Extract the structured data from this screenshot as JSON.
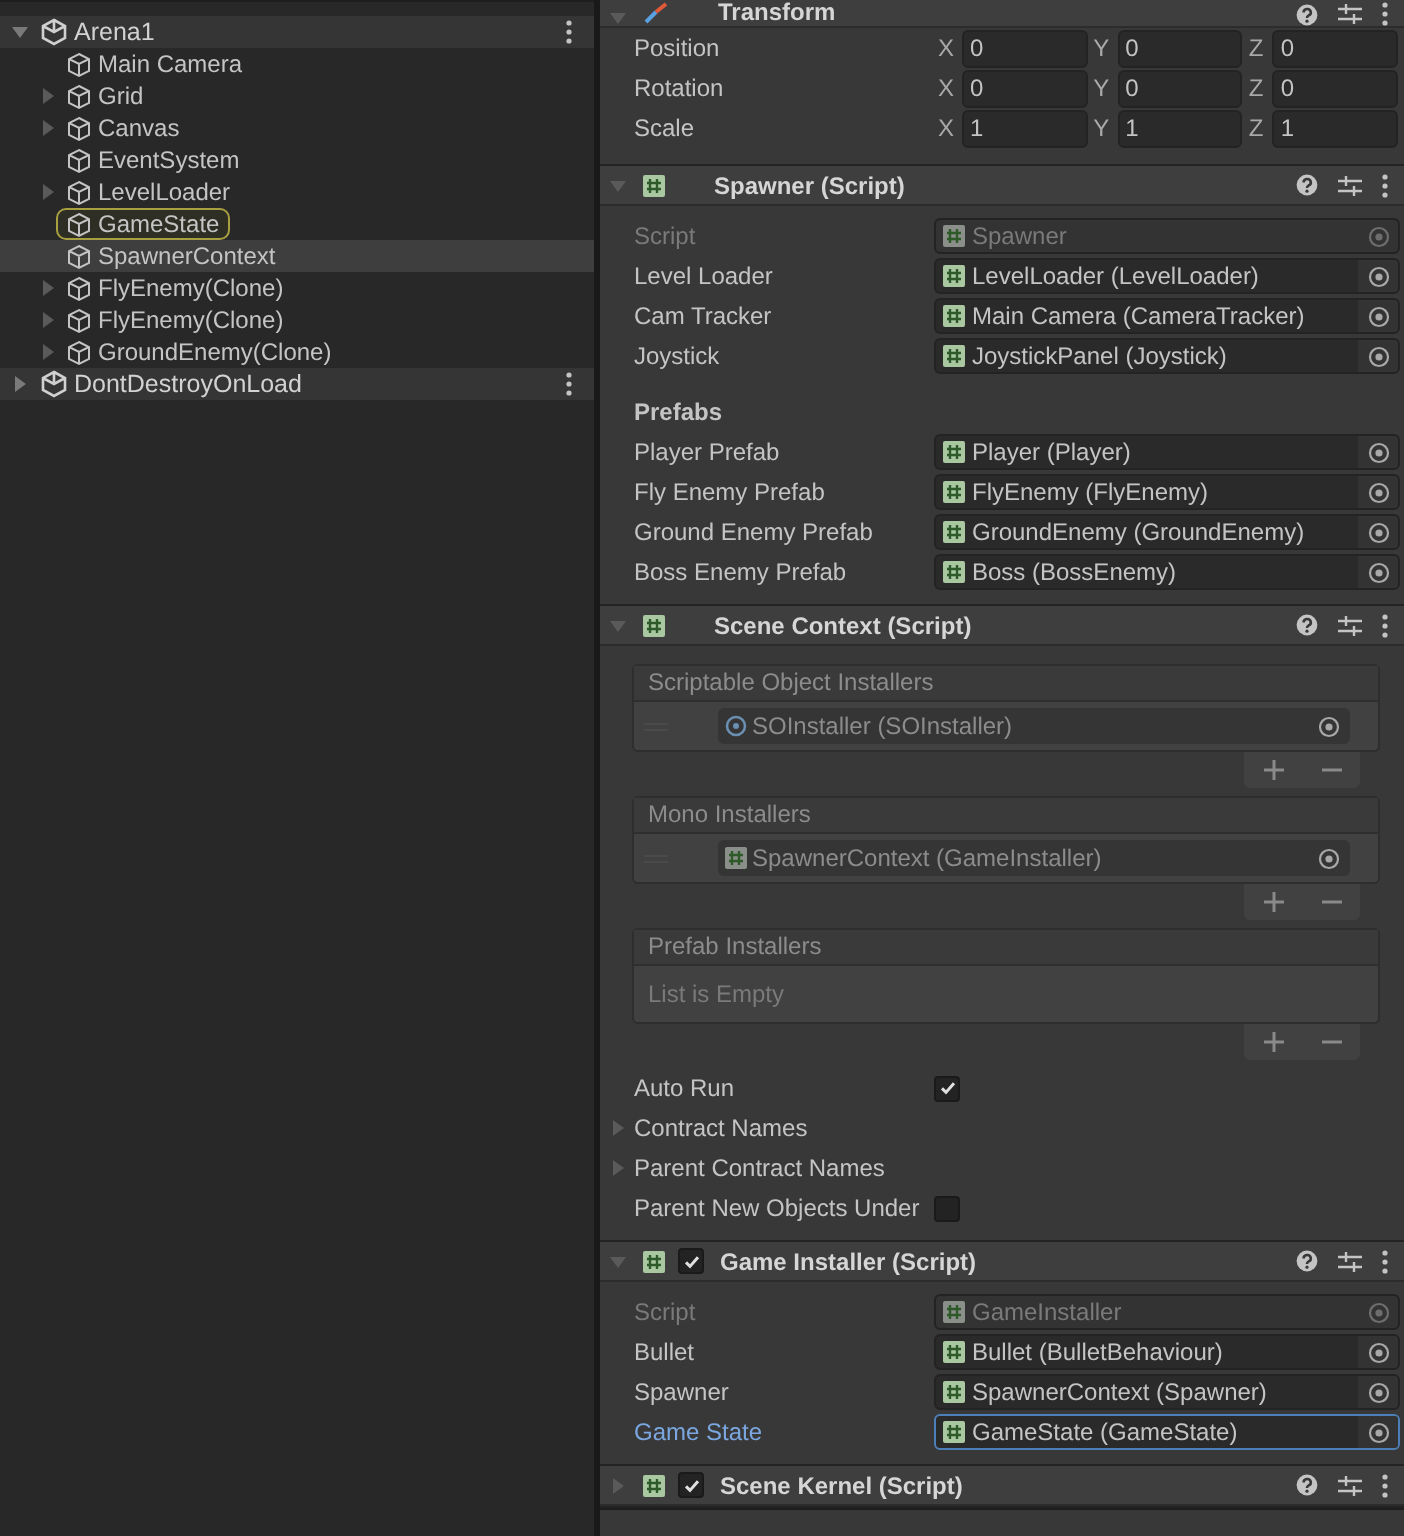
{
  "hierarchy": {
    "scenes": [
      {
        "name": "Arena1",
        "expanded": true,
        "children": [
          {
            "name": "Main Camera",
            "expandable": false,
            "selected": false,
            "pinged": false
          },
          {
            "name": "Grid",
            "expandable": true,
            "selected": false,
            "pinged": false
          },
          {
            "name": "Canvas",
            "expandable": true,
            "selected": false,
            "pinged": false
          },
          {
            "name": "EventSystem",
            "expandable": false,
            "selected": false,
            "pinged": false
          },
          {
            "name": "LevelLoader",
            "expandable": true,
            "selected": false,
            "pinged": false
          },
          {
            "name": "GameState",
            "expandable": false,
            "selected": false,
            "pinged": true
          },
          {
            "name": "SpawnerContext",
            "expandable": false,
            "selected": true,
            "pinged": false
          },
          {
            "name": "FlyEnemy(Clone)",
            "expandable": true,
            "selected": false,
            "pinged": false
          },
          {
            "name": "FlyEnemy(Clone)",
            "expandable": true,
            "selected": false,
            "pinged": false
          },
          {
            "name": "GroundEnemy(Clone)",
            "expandable": true,
            "selected": false,
            "pinged": false
          }
        ]
      },
      {
        "name": "DontDestroyOnLoad",
        "expanded": false
      }
    ]
  },
  "inspector": {
    "components": [
      {
        "title": "Transform",
        "expanded": true,
        "fields": [
          {
            "kind": "vector3",
            "label": "Position",
            "axes": [
              {
                "axis": "X",
                "value": "0"
              },
              {
                "axis": "Y",
                "value": "0"
              },
              {
                "axis": "Z",
                "value": "0"
              }
            ]
          },
          {
            "kind": "vector3",
            "label": "Rotation",
            "axes": [
              {
                "axis": "X",
                "value": "0"
              },
              {
                "axis": "Y",
                "value": "0"
              },
              {
                "axis": "Z",
                "value": "0"
              }
            ]
          },
          {
            "kind": "vector3",
            "label": "Scale",
            "axes": [
              {
                "axis": "X",
                "value": "1"
              },
              {
                "axis": "Y",
                "value": "1"
              },
              {
                "axis": "Z",
                "value": "1"
              }
            ]
          }
        ]
      },
      {
        "title": "Spawner (Script)",
        "expanded": true,
        "fields": [
          {
            "kind": "object",
            "label": "Script",
            "value": "Spawner",
            "disabled": true,
            "focused": false
          },
          {
            "kind": "object",
            "label": "Level Loader",
            "value": "LevelLoader (LevelLoader)",
            "disabled": false,
            "focused": false
          },
          {
            "kind": "object",
            "label": "Cam Tracker",
            "value": "Main Camera (CameraTracker)",
            "disabled": false,
            "focused": false
          },
          {
            "kind": "object",
            "label": "Joystick",
            "value": "JoystickPanel (Joystick)",
            "disabled": false,
            "focused": false
          },
          {
            "kind": "heading",
            "label": "Prefabs"
          },
          {
            "kind": "object",
            "label": "Player Prefab",
            "value": "Player (Player)",
            "disabled": false,
            "focused": false
          },
          {
            "kind": "object",
            "label": "Fly Enemy Prefab",
            "value": "FlyEnemy (FlyEnemy)",
            "disabled": false,
            "focused": false
          },
          {
            "kind": "object",
            "label": "Ground Enemy Prefab",
            "value": "GroundEnemy (GroundEnemy)",
            "disabled": false,
            "focused": false
          },
          {
            "kind": "object",
            "label": "Boss Enemy Prefab",
            "value": "Boss (BossEnemy)",
            "disabled": false,
            "focused": false
          }
        ]
      },
      {
        "title": "Scene Context (Script)",
        "expanded": true,
        "fields": [
          {
            "kind": "list",
            "title": "Scriptable Object Installers",
            "items": [
              {
                "value": "SOInstaller (SOInstaller)"
              }
            ]
          },
          {
            "kind": "list",
            "title": "Mono Installers",
            "items": [
              {
                "value": "SpawnerContext (GameInstaller)"
              }
            ]
          },
          {
            "kind": "list",
            "title": "Prefab Installers",
            "empty_text": "List is Empty"
          },
          {
            "kind": "checkbox",
            "label": "Auto Run",
            "checked": true
          },
          {
            "kind": "foldout",
            "label": "Contract Names",
            "expanded": false
          },
          {
            "kind": "foldout",
            "label": "Parent Contract Names",
            "expanded": false
          },
          {
            "kind": "checkbox",
            "label": "Parent New Objects Under",
            "checked": false
          }
        ]
      },
      {
        "title": "Game Installer (Script)",
        "expanded": true,
        "toggle": {
          "checked": true
        },
        "fields": [
          {
            "kind": "object",
            "label": "Script",
            "value": "GameInstaller",
            "disabled": true,
            "focused": false
          },
          {
            "kind": "object",
            "label": "Bullet",
            "value": "Bullet (BulletBehaviour)",
            "disabled": false,
            "focused": false
          },
          {
            "kind": "object",
            "label": "Spawner",
            "value": "SpawnerContext (Spawner)",
            "disabled": false,
            "focused": false
          },
          {
            "kind": "object",
            "label": "Game State",
            "value": "GameState (GameState)",
            "disabled": false,
            "focused": true
          }
        ]
      },
      {
        "title": "Scene Kernel (Script)",
        "expanded": false,
        "toggle": {
          "checked": true
        }
      }
    ]
  }
}
